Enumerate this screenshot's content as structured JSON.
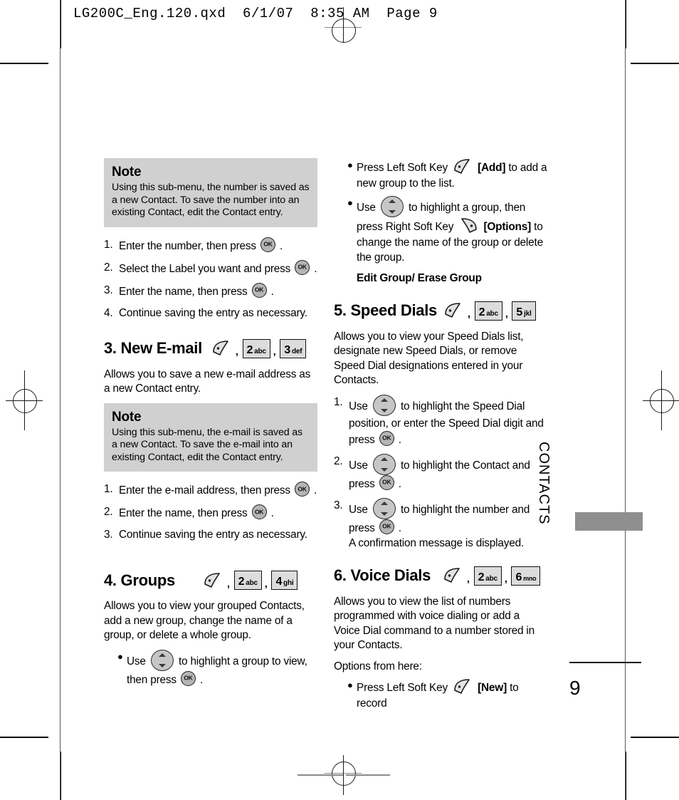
{
  "header": {
    "slug": "LG200C_Eng.120.qxd  6/1/07  8:35 AM  Page 9"
  },
  "side_tab": {
    "label": "CONTACTS"
  },
  "page_number": "9",
  "left_column": {
    "note1": {
      "title": "Note",
      "body": "Using this sub-menu, the number is saved as a new Contact. To save the number into an existing Contact, edit the Contact entry."
    },
    "steps1": [
      {
        "num": "1.",
        "before": "Enter the number, then press",
        "icon": "ok-key-icon",
        "after": "."
      },
      {
        "num": "2.",
        "before": "Select the Label you want and press",
        "icon": "ok-key-icon",
        "after": "."
      },
      {
        "num": "3.",
        "before": "Enter the name, then press",
        "icon": "ok-key-icon",
        "after": "."
      },
      {
        "num": "4.",
        "before": "Continue saving the entry as necessary.",
        "icon": "",
        "after": ""
      }
    ],
    "section3": {
      "title": "3. New E-mail",
      "keys": [
        {
          "type": "softkey-left",
          "digit": "",
          "letters": ""
        },
        {
          "type": "keycap",
          "digit": "2",
          "letters": "abc"
        },
        {
          "type": "keycap",
          "digit": "3",
          "letters": "def"
        }
      ],
      "paragraph": "Allows you to save a new e-mail address as a new Contact entry.",
      "note": {
        "title": "Note",
        "body": "Using this sub-menu, the e-mail is saved as a new Contact. To save the e-mail into an existing Contact, edit the Contact entry."
      },
      "steps": [
        {
          "num": "1.",
          "before": "Enter the e-mail address, then press",
          "icon": "ok-key-icon",
          "after": "."
        },
        {
          "num": "2.",
          "before": "Enter the name, then press",
          "icon": "ok-key-icon",
          "after": "."
        },
        {
          "num": "3.",
          "before": "Continue saving the entry as necessary.",
          "icon": "",
          "after": ""
        }
      ]
    },
    "section4": {
      "title": "4. Groups",
      "keys": [
        {
          "type": "softkey-left",
          "digit": "",
          "letters": ""
        },
        {
          "type": "keycap",
          "digit": "2",
          "letters": "abc"
        },
        {
          "type": "keycap",
          "digit": "4",
          "letters": "ghi"
        }
      ],
      "paragraph": "Allows you to view your grouped Contacts, add a new group, change the name of a group, or delete a whole group.",
      "bullet": {
        "before": "Use",
        "icon": "nav-key-icon",
        "middle": "to highlight a group to view, then press",
        "icon2": "ok-key-icon",
        "after": "."
      }
    }
  },
  "right_column": {
    "group_bullets": {
      "bullet1": {
        "before": "Press Left Soft Key",
        "icon": "left-soft-key-icon",
        "label": "[Add]",
        "after": "to add a new group to the list."
      },
      "bullet2": {
        "before": "Use",
        "icon": "nav-key-icon",
        "middle": "to highlight a group, then press Right Soft Key",
        "icon2": "right-soft-key-icon",
        "label": "[Options]",
        "after": "to change the name of the group or delete the group."
      },
      "subline": "Edit Group/ Erase Group"
    },
    "section5": {
      "title": "5. Speed Dials",
      "keys": [
        {
          "type": "softkey-left",
          "digit": "",
          "letters": ""
        },
        {
          "type": "keycap",
          "digit": "2",
          "letters": "abc"
        },
        {
          "type": "keycap",
          "digit": "5",
          "letters": "jkl"
        }
      ],
      "paragraph": "Allows you to view your Speed Dials list, designate new Speed Dials, or remove Speed Dial designations entered in your Contacts.",
      "steps": [
        {
          "num": "1.",
          "before": "Use",
          "icon": "nav-key-icon",
          "middle": "to highlight the Speed Dial position, or enter the Speed Dial digit and press",
          "icon2": "ok-key-icon",
          "after": "."
        },
        {
          "num": "2.",
          "before": "Use",
          "icon": "nav-key-icon",
          "middle": "to highlight the Contact and press",
          "icon2": "ok-key-icon",
          "after": "."
        },
        {
          "num": "3.",
          "before": "Use",
          "icon": "nav-key-icon",
          "middle": "to highlight the number and press",
          "icon2": "ok-key-icon",
          "after": "."
        }
      ],
      "closing": "A confirmation message is displayed."
    },
    "section6": {
      "title": "6. Voice Dials",
      "keys": [
        {
          "type": "softkey-left",
          "digit": "",
          "letters": ""
        },
        {
          "type": "keycap",
          "digit": "2",
          "letters": "abc"
        },
        {
          "type": "keycap",
          "digit": "6",
          "letters": "mno"
        }
      ],
      "paragraph": "Allows you to view the list of numbers programmed with voice dialing or add a Voice Dial command to a number stored in your Contacts.",
      "options_intro": "Options from here:",
      "bullet": {
        "before": "Press Left Soft Key",
        "icon": "left-soft-key-icon",
        "label": "[New]",
        "after": "to record"
      }
    }
  },
  "colors": {
    "note_bg": "#d0d0d0",
    "keycap_bg": "#dcdcdc",
    "sidetab_gray": "#8f8f8f",
    "ok_key_gray": "#b5b5b5"
  }
}
